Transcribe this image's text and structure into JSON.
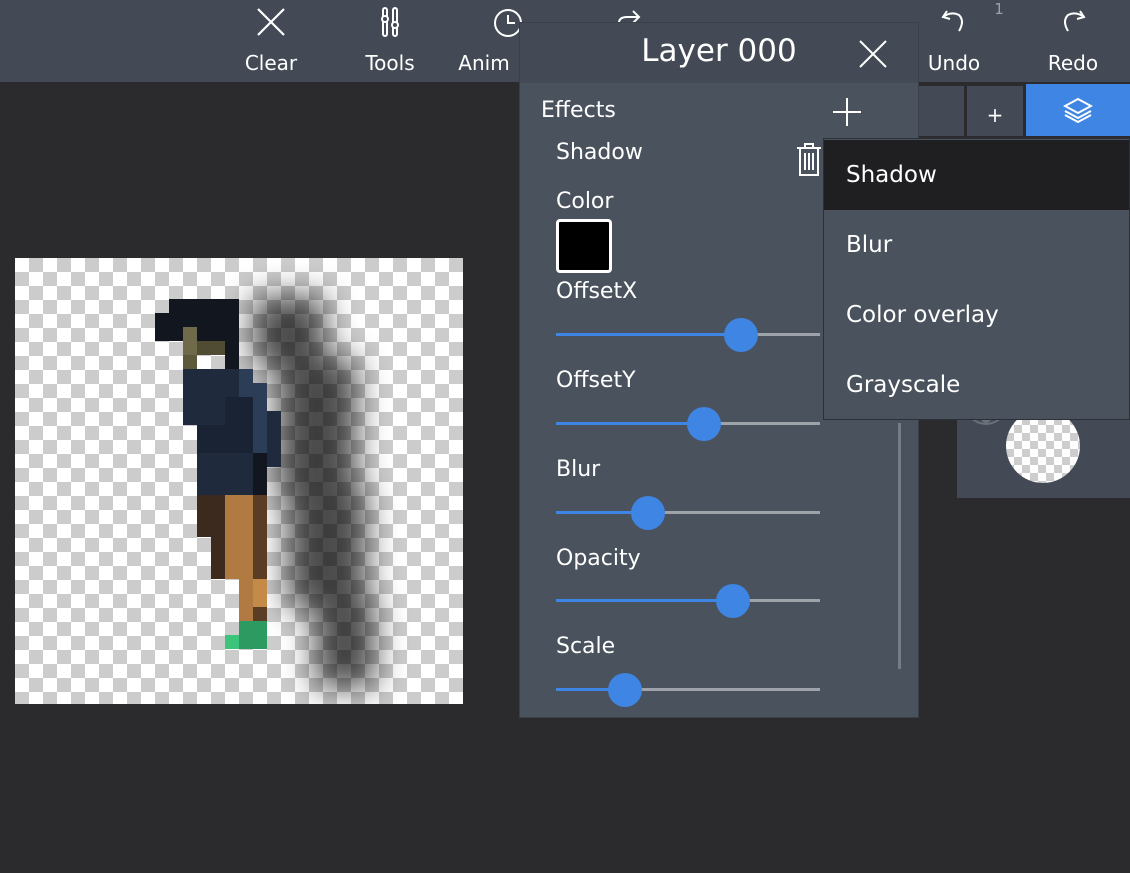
{
  "toolbar": {
    "clear_label": "Clear",
    "tools_label": "Tools",
    "anim_label": "Anim",
    "undo_label": "Undo",
    "undo_count": "1",
    "redo_label": "Redo"
  },
  "layers_panel": {
    "add_label": "+"
  },
  "dialog": {
    "title": "Layer 000",
    "effects_label": "Effects",
    "effect_name": "Shadow",
    "color_label": "Color",
    "color_value": "#000000",
    "sliders": [
      {
        "label": "OffsetX",
        "value": 0.7
      },
      {
        "label": "OffsetY",
        "value": 0.56
      },
      {
        "label": "Blur",
        "value": 0.35
      },
      {
        "label": "Opacity",
        "value": 0.67
      },
      {
        "label": "Scale",
        "value": 0.26
      }
    ]
  },
  "effect_menu": {
    "items": [
      "Shadow",
      "Blur",
      "Color overlay",
      "Grayscale"
    ],
    "selected": "Shadow"
  },
  "colors": {
    "accent": "#3f85e3",
    "panel": "#4a525d",
    "toolbar": "#434a55",
    "background": "#2b2b2e"
  }
}
